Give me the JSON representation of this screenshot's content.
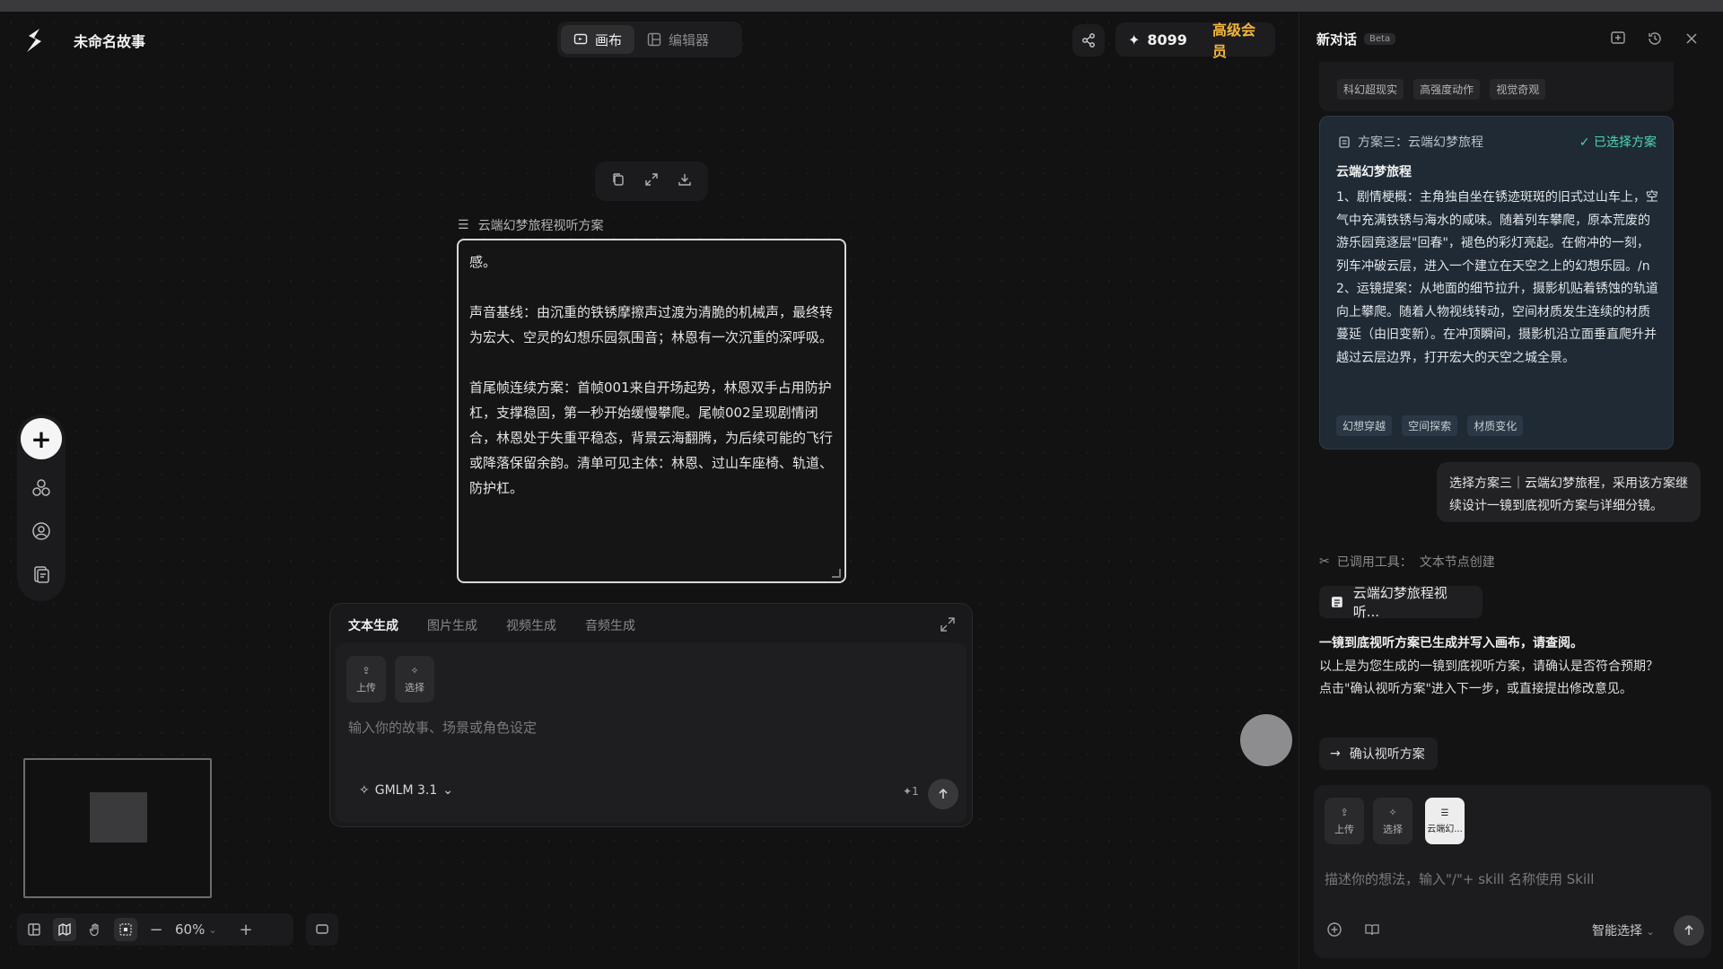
{
  "header": {
    "title": "未命名故事",
    "tabs": [
      {
        "label": "画布",
        "icon": "canvas-icon"
      },
      {
        "label": "编辑器",
        "icon": "editor-icon"
      }
    ],
    "credits": "8099",
    "membership": "高级会员"
  },
  "node": {
    "label": "云端幻梦旅程视听方案",
    "paragraphs": [
      "感。",
      "声音基线：由沉重的铁锈摩擦声过渡为清脆的机械声，最终转为宏大、空灵的幻想乐园氛围音；林恩有一次沉重的深呼吸。",
      "首尾帧连续方案：首帧001来自开场起势，林恩双手占用防护杠，支撑稳固，第一秒开始缓慢攀爬。尾帧002呈现剧情闭合，林恩处于失重平稳态，背景云海翻腾，为后续可能的飞行或降落保留余韵。清单可见主体：林恩、过山车座椅、轨道、防护杠。"
    ]
  },
  "gen_panel": {
    "tabs": [
      "文本生成",
      "图片生成",
      "视频生成",
      "音频生成"
    ],
    "upload_label": "上传",
    "select_label": "选择",
    "placeholder": "输入你的故事、场景或角色设定",
    "model": "GMLM 3.1",
    "cost": "1"
  },
  "zoom": "60%",
  "chat": {
    "title": "新对话",
    "beta": "Beta",
    "prev_tags": [
      "科幻超现实",
      "高强度动作",
      "视觉奇观"
    ],
    "plan": {
      "header": "方案三：云端幻梦旅程",
      "chosen": "✓ 已选择方案",
      "name": "云端幻梦旅程",
      "body": "1、剧情梗概：主角独自坐在锈迹斑斑的旧式过山车上，空气中充满铁锈与海水的咸味。随着列车攀爬，原本荒废的游乐园竟逐层\"回春\"，褪色的彩灯亮起。在俯冲的一刻，列车冲破云层，进入一个建立在天空之上的幻想乐园。/n 2、运镜提案：从地面的细节拉升，摄影机贴着锈蚀的轨道向上攀爬。随着人物视线转动，空间材质发生连续的材质蔓延（由旧变新）。在冲顶瞬间，摄影机沿立面垂直爬升并越过云层边界，打开宏大的天空之城全景。",
      "tags": [
        "幻想穿越",
        "空间探索",
        "材质变化"
      ]
    },
    "user_message": "选择方案三｜云端幻梦旅程，采用该方案继续设计一镜到底视听方案与详细分镜。",
    "tool_used_label": "已调用工具：",
    "tool_used_name": "文本节点创建",
    "doc_chip": "云端幻梦旅程视听...",
    "reply_bold": "一镜到底视听方案已生成并写入画布，请查阅。",
    "reply": "以上是为您生成的一镜到底视听方案，请确认是否符合预期？点击\"确认视听方案\"进入下一步，或直接提出修改意见。",
    "confirm_label": "确认视听方案",
    "input": {
      "upload_label": "上传",
      "select_label": "选择",
      "chip_label": "云端幻...",
      "placeholder": "描述你的想法，输入\"/\"+ skill 名称使用 Skill",
      "smart_select": "智能选择"
    }
  }
}
